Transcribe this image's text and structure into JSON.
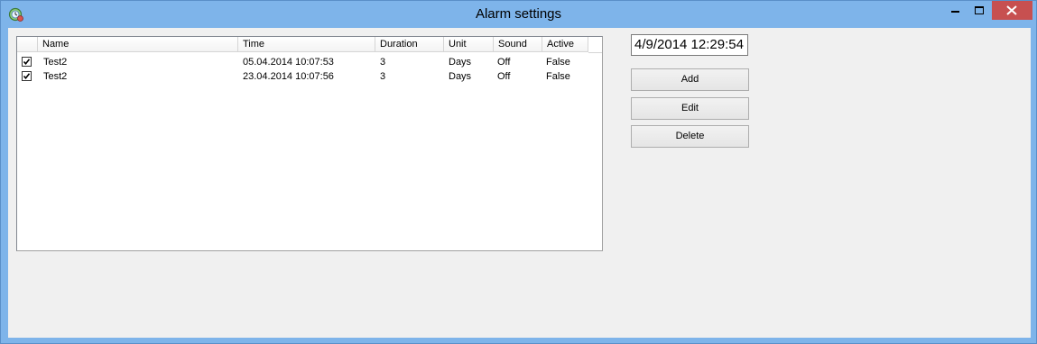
{
  "window": {
    "title": "Alarm settings",
    "icon": "alarm-app-icon",
    "controls": {
      "minimize": "minimize-icon",
      "maximize": "maximize-icon",
      "close": "close-icon"
    },
    "colors": {
      "titlebar": "#7eb4ea",
      "close": "#c75050",
      "client": "#f0f0f0"
    }
  },
  "list": {
    "columns": [
      "Name",
      "Time",
      "Duration",
      "Unit",
      "Sound",
      "Active"
    ],
    "rows": [
      {
        "checked": true,
        "name": "Test2",
        "time": "05.04.2014 10:07:53",
        "duration": "3",
        "unit": "Days",
        "sound": "Off",
        "active": "False"
      },
      {
        "checked": true,
        "name": "Test2",
        "time": "23.04.2014 10:07:56",
        "duration": "3",
        "unit": "Days",
        "sound": "Off",
        "active": "False"
      }
    ]
  },
  "datetime": {
    "value": "4/9/2014 12:29:54"
  },
  "buttons": {
    "add": "Add",
    "edit": "Edit",
    "delete": "Delete"
  }
}
